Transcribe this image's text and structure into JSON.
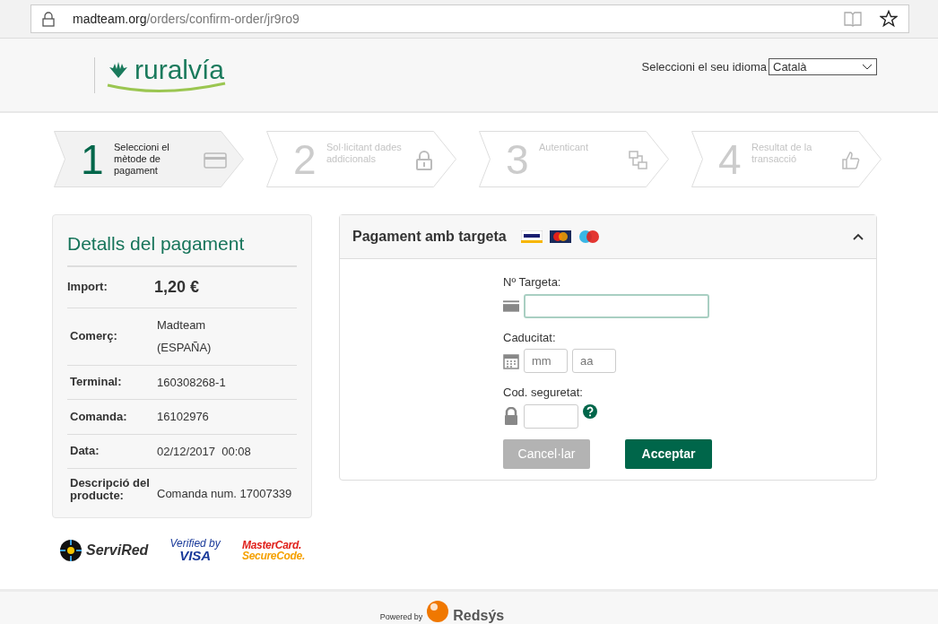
{
  "browser": {
    "url_host": "madteam.org",
    "url_path": "/orders/confirm-order/jr9ro9"
  },
  "header": {
    "logo_text": "ruralvía",
    "language_label": "Seleccioni el seu idioma",
    "language_value": "Català"
  },
  "steps": [
    {
      "number": "1",
      "label": "Seleccioni el mètode de pagament",
      "selected": true,
      "kind": "card"
    },
    {
      "number": "2",
      "label": "Sol·licitant dades addicionals",
      "selected": false,
      "kind": "lock"
    },
    {
      "number": "3",
      "label": "Autenticant",
      "selected": false,
      "kind": "auth"
    },
    {
      "number": "4",
      "label": "Resultat de la transacció",
      "selected": false,
      "kind": "thumb"
    }
  ],
  "details": {
    "title": "Detalls del pagament",
    "rows": [
      {
        "label": "Import:",
        "value": [
          "1,20 €"
        ],
        "kind": "amount"
      },
      {
        "label": "Comerç:",
        "value": [
          "Madteam",
          "(ESPAÑA)"
        ],
        "kind": "text"
      },
      {
        "label": "Terminal:",
        "value": [
          "160308268-1"
        ],
        "kind": "text"
      },
      {
        "label": "Comanda:",
        "value": [
          "16102976"
        ],
        "kind": "text"
      },
      {
        "label": "Data:",
        "value": [
          "02/12/2017  00:08"
        ],
        "kind": "text"
      },
      {
        "label": "Descripció del producte:",
        "value": [
          "Comanda num. 17007339"
        ],
        "kind": "text"
      }
    ]
  },
  "trust_logos": [
    {
      "text": "ServiRed",
      "kind": "servired"
    },
    {
      "text": "Verified by",
      "text2": "VISA",
      "kind": "visa"
    },
    {
      "text": "MasterCard.",
      "text2": "SecureCode.",
      "kind": "mc"
    }
  ],
  "card_form": {
    "title": "Pagament amb targeta",
    "expanded": true,
    "fields": [
      {
        "label": "Nº Targeta:",
        "kind": "card",
        "inputs": [
          {
            "focused": true
          }
        ]
      },
      {
        "label": "Caducitat:",
        "kind": "date",
        "inputs": [
          {
            "placeholder": "mm",
            "focused": false
          },
          {
            "placeholder": "aa",
            "focused": false
          }
        ]
      },
      {
        "label": "Cod. seguretat:",
        "kind": "cvv",
        "inputs": [
          {
            "focused": false
          }
        ]
      }
    ],
    "buttons": [
      {
        "label": "Cancel·lar",
        "disabled": true
      },
      {
        "label": "Acceptar",
        "disabled": false
      }
    ]
  },
  "footer": {
    "powered_by": "Powered by",
    "brand": "Redsýs"
  }
}
